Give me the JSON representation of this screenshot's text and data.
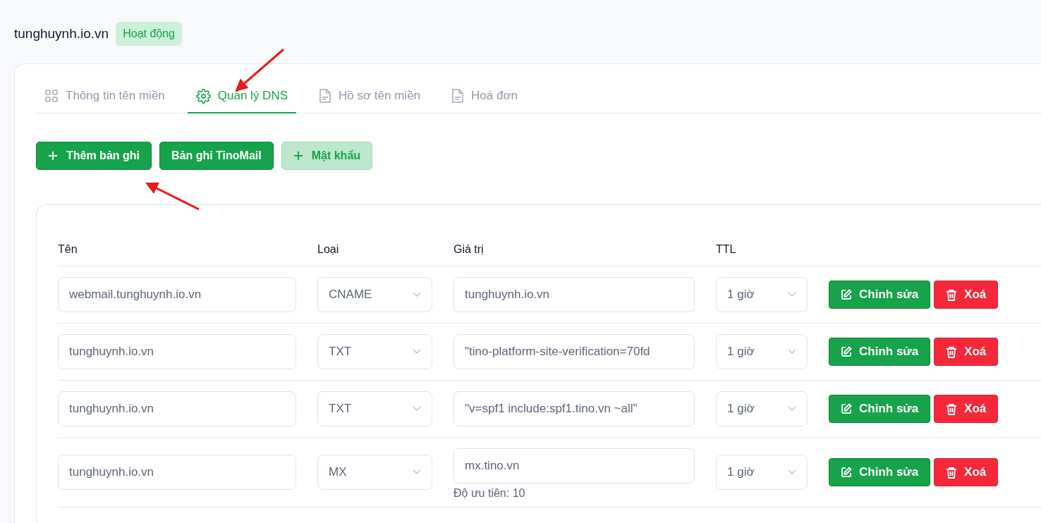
{
  "domain": {
    "name": "tunghuynh.io.vn",
    "status": "Hoạt động"
  },
  "tabs": [
    {
      "label": "Thông tin tên miền",
      "kind": "overview",
      "selected": false
    },
    {
      "label": "Quản lý DNS",
      "kind": "settings",
      "selected": true
    },
    {
      "label": "Hồ sơ tên miền",
      "kind": "document",
      "selected": false
    },
    {
      "label": "Hoá đơn",
      "kind": "document",
      "selected": false
    }
  ],
  "actions": [
    {
      "label": "Thêm bản ghi",
      "has_icon": true,
      "disabled": false
    },
    {
      "label": "Bản ghi TinoMail",
      "has_icon": false,
      "disabled": false
    },
    {
      "label": "Mật khẩu",
      "has_icon": true,
      "disabled": true
    }
  ],
  "table": {
    "columns": [
      "Tên",
      "Loại",
      "Giá trị",
      "TTL"
    ],
    "rows": [
      {
        "name": "webmail.tunghuynh.io.vn",
        "type": "CNAME",
        "value": "tunghuynh.io.vn",
        "ttl": "1 giờ",
        "edit": "Chỉnh sửa",
        "delete": "Xoá"
      },
      {
        "name": "tunghuynh.io.vn",
        "type": "TXT",
        "value": "\"tino-platform-site-verification=70fd",
        "ttl": "1 giờ",
        "edit": "Chỉnh sửa",
        "delete": "Xoá"
      },
      {
        "name": "tunghuynh.io.vn",
        "type": "TXT",
        "value": "\"v=spf1 include:spf1.tino.vn ~all\"",
        "ttl": "1 giờ",
        "edit": "Chỉnh sửa",
        "delete": "Xoá"
      },
      {
        "name": "tunghuynh.io.vn",
        "type": "MX",
        "value": "mx.tino.vn",
        "note": "Độ ưu tiên: 10",
        "ttl": "1 giờ",
        "edit": "Chỉnh sửa",
        "delete": "Xoá"
      }
    ]
  }
}
